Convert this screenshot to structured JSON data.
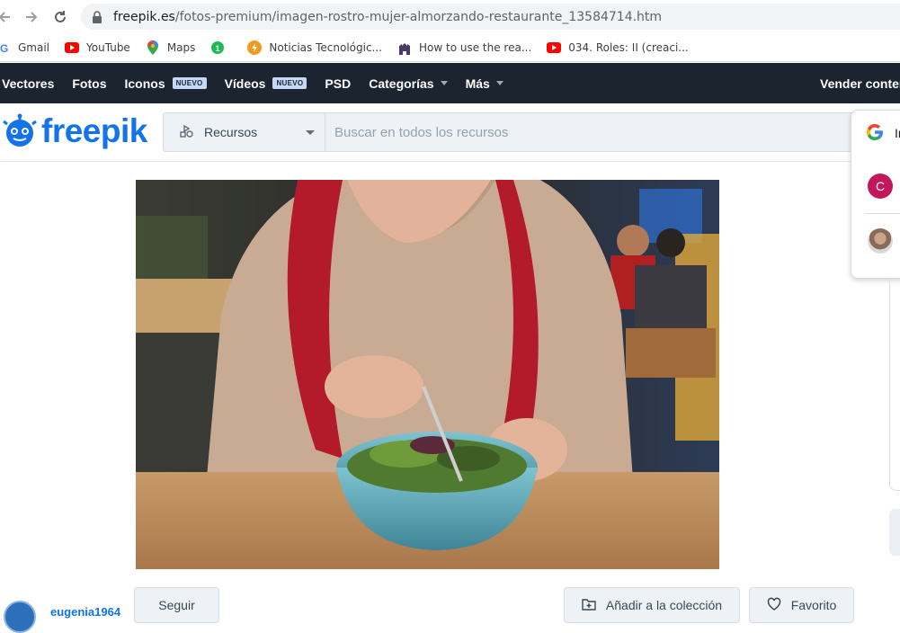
{
  "browser": {
    "url_host": "freepik.es",
    "url_path": "/fotos-premium/imagen-rostro-mujer-almorzando-restaurante_13584714.htm",
    "bookmarks": [
      {
        "label": "Gmail",
        "icon": "gmail-icon"
      },
      {
        "label": "YouTube",
        "icon": "youtube-icon"
      },
      {
        "label": "Maps",
        "icon": "maps-icon"
      },
      {
        "label": "",
        "icon": "green-badge-icon"
      },
      {
        "label": "Noticias Tecnológic...",
        "icon": "orange-bolt-icon"
      },
      {
        "label": "How to use the rea...",
        "icon": "castle-icon"
      },
      {
        "label": "034. Roles: II (creaci...",
        "icon": "youtube-icon"
      }
    ]
  },
  "nav": {
    "items": [
      {
        "label": "Vectores",
        "badge": "",
        "caret": false
      },
      {
        "label": "Fotos",
        "badge": "",
        "caret": false
      },
      {
        "label": "Iconos",
        "badge": "NUEVO",
        "caret": false
      },
      {
        "label": "Vídeos",
        "badge": "NUEVO",
        "caret": false
      },
      {
        "label": "PSD",
        "badge": "",
        "caret": false
      },
      {
        "label": "Categorías",
        "badge": "",
        "caret": true
      },
      {
        "label": "Más",
        "badge": "",
        "caret": true
      }
    ],
    "sell_label": "Vender conter"
  },
  "header": {
    "logo_text": "freepik",
    "resource_select": "Recursos",
    "search_placeholder": "Buscar en todos los recursos"
  },
  "google_popup": {
    "title_initial": "In",
    "account_initial": "C"
  },
  "footer": {
    "author_name": "eugenia1964",
    "follow_label": "Seguir",
    "add_collection_label": "Añadir a la colección",
    "favorite_label": "Favorito"
  },
  "colors": {
    "nav_bg": "#1c2430",
    "brand_blue": "#1273eb",
    "badge_bg": "#c3d9f5"
  }
}
